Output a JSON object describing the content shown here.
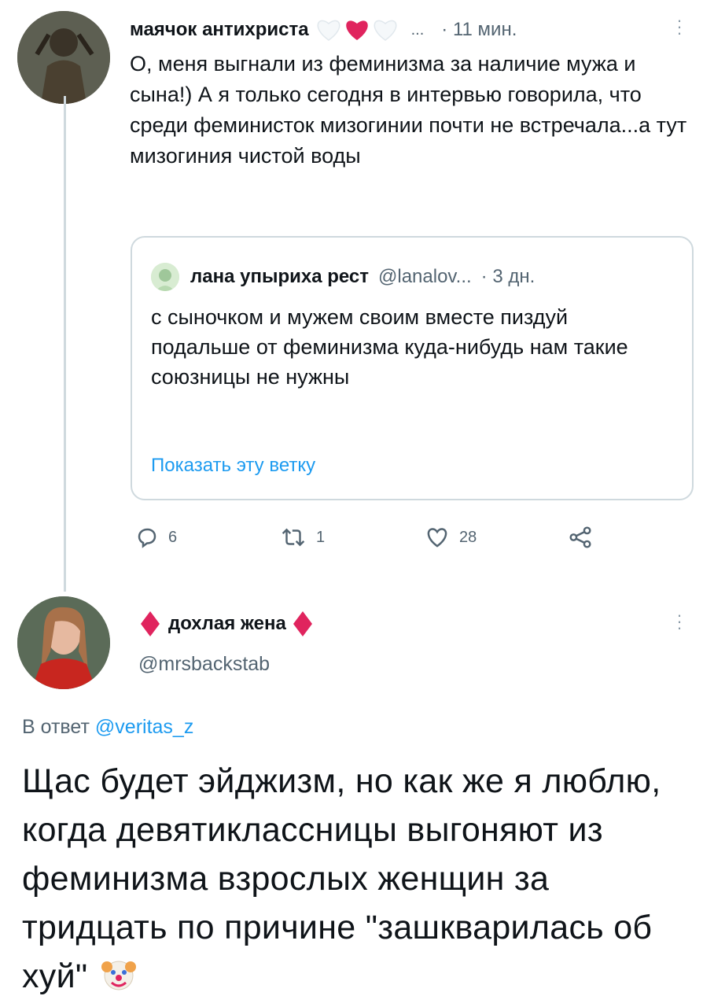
{
  "tweet1": {
    "author_name": "маячок антихриста",
    "name_emoji": [
      {
        "icon": "white-heart-icon",
        "color": "#e6ecf0"
      },
      {
        "icon": "red-heart-icon",
        "color": "#e0245e"
      },
      {
        "icon": "white-heart-icon",
        "color": "#e6ecf0"
      }
    ],
    "ellipsis": "...",
    "time": "· 11 мин.",
    "text": "О, меня выгнали из феминизма за наличие мужа и сына!) А я только сегодня в интервью говорила, что среди феминисток мизогинии почти не встречала...а тут мизогиния чистой воды",
    "quote": {
      "author_name": "лана упыриха рест",
      "handle": "@lanalov...",
      "time": "· 3 дн.",
      "text": "с сыночком и мужем своим вместе пиздуй подальше от феминизма куда-нибудь нам такие союзницы не нужны",
      "show_thread": "Показать эту ветку"
    },
    "actions": {
      "replies": "6",
      "retweets": "1",
      "likes": "28"
    }
  },
  "tweet2": {
    "author_name": "дохлая жена",
    "name_emoji_icon": "red-diamond-icon",
    "accent_color": "#e0245e",
    "handle": "@mrsbackstab",
    "reply_prefix": "В ответ",
    "reply_to": "@veritas_z",
    "text": "Щас будет эйджизм, но как же я люблю, когда девятиклассницы выгоняют из феминизма взрослых женщин за тридцать по причине \"зашкварилась об хуй\"",
    "trailing_emoji": "clown-face-icon"
  }
}
